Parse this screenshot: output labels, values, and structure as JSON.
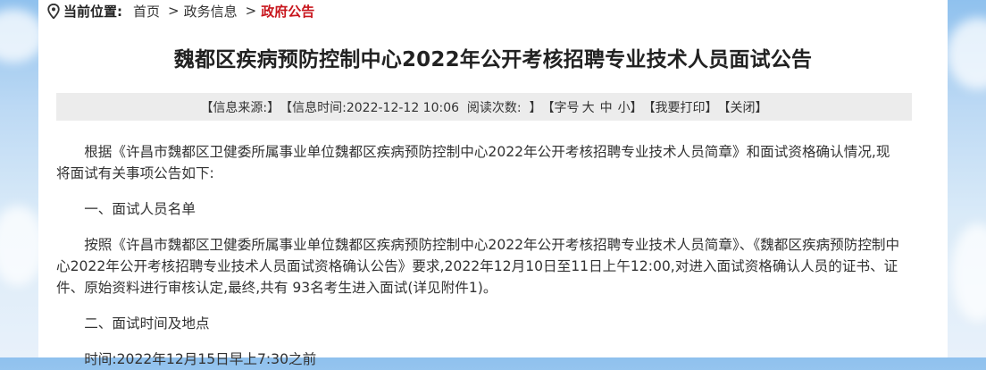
{
  "breadcrumb": {
    "label": "当前位置:",
    "home": "首页",
    "separator": ">",
    "section": "政务信息",
    "current": "政府公告"
  },
  "article": {
    "title": "魏都区疾病预防控制中心2022年公开考核招聘专业技术人员面试公告",
    "info": {
      "source": "【信息来源:】",
      "time": "【信息时间:2022-12-12 10:06  阅读次数:  】",
      "font_size_open": "【字号",
      "font_large": "大",
      "font_medium": "中",
      "font_small": "小】",
      "print": "【我要打印】",
      "close": "【关闭】"
    },
    "paragraphs": [
      "根据《许昌市魏都区卫健委所属事业单位魏都区疾病预防控制中心2022年公开考核招聘专业技术人员简章》和面试资格确认情况,现将面试有关事项公告如下:",
      "一、面试人员名单",
      "按照《许昌市魏都区卫健委所属事业单位魏都区疾病预防控制中心2022年公开考核招聘专业技术人员简章》、《魏都区疾病预防控制中心2022年公开考核招聘专业技术人员面试资格确认公告》要求,2022年12月10日至11日上午12:00,对进入面试资格确认人员的证书、证件、原始资料进行审核认定,最终,共有 93名考生进入面试(详见附件1)。",
      "二、面试时间及地点",
      "时间:2022年12月15日早上7:30之前"
    ]
  },
  "colors": {
    "accent_red": "#c8161d",
    "info_bar_bg": "#ececec",
    "text": "#333333"
  }
}
